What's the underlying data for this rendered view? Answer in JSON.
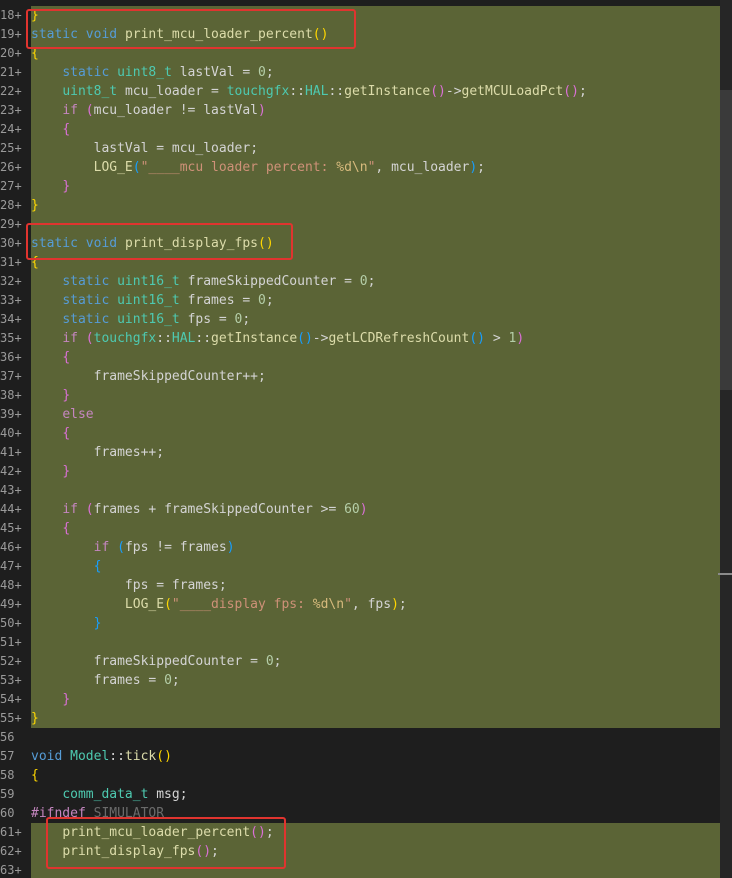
{
  "editor": {
    "lines": [
      {
        "n": "18",
        "m": "+",
        "hl": true,
        "segs": [
          [
            "pun",
            "}"
          ]
        ]
      },
      {
        "n": "19",
        "m": "+",
        "hl": true,
        "segs": [
          [
            "kw",
            "static"
          ],
          [
            "op",
            " "
          ],
          [
            "kw",
            "void"
          ],
          [
            "op",
            " "
          ],
          [
            "fn",
            "print_mcu_loader_percent"
          ],
          [
            "pun",
            "()"
          ]
        ]
      },
      {
        "n": "20",
        "m": "+",
        "hl": true,
        "segs": [
          [
            "pun",
            "{"
          ]
        ]
      },
      {
        "n": "21",
        "m": "+",
        "hl": true,
        "segs": [
          [
            "op",
            "    "
          ],
          [
            "kw",
            "static"
          ],
          [
            "op",
            " "
          ],
          [
            "ty",
            "uint8_t"
          ],
          [
            "op",
            " "
          ],
          [
            "id",
            "lastVal"
          ],
          [
            "op",
            " = "
          ],
          [
            "num",
            "0"
          ],
          [
            "op",
            ";"
          ]
        ]
      },
      {
        "n": "22",
        "m": "+",
        "hl": true,
        "segs": [
          [
            "op",
            "    "
          ],
          [
            "ty",
            "uint8_t"
          ],
          [
            "op",
            " "
          ],
          [
            "id",
            "mcu_loader"
          ],
          [
            "op",
            " = "
          ],
          [
            "ns",
            "touchgfx"
          ],
          [
            "op",
            "::"
          ],
          [
            "ns",
            "HAL"
          ],
          [
            "op",
            "::"
          ],
          [
            "fn",
            "getInstance"
          ],
          [
            "pr2",
            "()"
          ],
          [
            "op",
            "->"
          ],
          [
            "fn",
            "getMCULoadPct"
          ],
          [
            "pr2",
            "()"
          ],
          [
            "op",
            ";"
          ]
        ]
      },
      {
        "n": "23",
        "m": "+",
        "hl": true,
        "segs": [
          [
            "op",
            "    "
          ],
          [
            "mac",
            "if"
          ],
          [
            "op",
            " "
          ],
          [
            "pr2",
            "("
          ],
          [
            "id",
            "mcu_loader"
          ],
          [
            "op",
            " != "
          ],
          [
            "id",
            "lastVal"
          ],
          [
            "pr2",
            ")"
          ]
        ]
      },
      {
        "n": "24",
        "m": "+",
        "hl": true,
        "segs": [
          [
            "op",
            "    "
          ],
          [
            "pr2",
            "{"
          ]
        ]
      },
      {
        "n": "25",
        "m": "+",
        "hl": true,
        "segs": [
          [
            "op",
            "        "
          ],
          [
            "id",
            "lastVal"
          ],
          [
            "op",
            " = "
          ],
          [
            "id",
            "mcu_loader"
          ],
          [
            "op",
            ";"
          ]
        ]
      },
      {
        "n": "26",
        "m": "+",
        "hl": true,
        "segs": [
          [
            "op",
            "        "
          ],
          [
            "fn",
            "LOG_E"
          ],
          [
            "pr3",
            "("
          ],
          [
            "str",
            "\"____mcu loader percent: "
          ],
          [
            "esc",
            "%d\\n"
          ],
          [
            "str",
            "\""
          ],
          [
            "op",
            ", "
          ],
          [
            "id",
            "mcu_loader"
          ],
          [
            "pr3",
            ")"
          ],
          [
            "op",
            ";"
          ]
        ]
      },
      {
        "n": "27",
        "m": "+",
        "hl": true,
        "segs": [
          [
            "op",
            "    "
          ],
          [
            "pr2",
            "}"
          ]
        ]
      },
      {
        "n": "28",
        "m": "+",
        "hl": true,
        "segs": [
          [
            "pun",
            "}"
          ]
        ]
      },
      {
        "n": "29",
        "m": "+",
        "hl": true,
        "segs": []
      },
      {
        "n": "30",
        "m": "+",
        "hl": true,
        "segs": [
          [
            "kw",
            "static"
          ],
          [
            "op",
            " "
          ],
          [
            "kw",
            "void"
          ],
          [
            "op",
            " "
          ],
          [
            "fn",
            "print_display_fps"
          ],
          [
            "pun",
            "()"
          ]
        ]
      },
      {
        "n": "31",
        "m": "+",
        "hl": true,
        "segs": [
          [
            "pun",
            "{"
          ]
        ]
      },
      {
        "n": "32",
        "m": "+",
        "hl": true,
        "segs": [
          [
            "op",
            "    "
          ],
          [
            "kw",
            "static"
          ],
          [
            "op",
            " "
          ],
          [
            "ty",
            "uint16_t"
          ],
          [
            "op",
            " "
          ],
          [
            "id",
            "frameSkippedCounter"
          ],
          [
            "op",
            " = "
          ],
          [
            "num",
            "0"
          ],
          [
            "op",
            ";"
          ]
        ]
      },
      {
        "n": "33",
        "m": "+",
        "hl": true,
        "segs": [
          [
            "op",
            "    "
          ],
          [
            "kw",
            "static"
          ],
          [
            "op",
            " "
          ],
          [
            "ty",
            "uint16_t"
          ],
          [
            "op",
            " "
          ],
          [
            "id",
            "frames"
          ],
          [
            "op",
            " = "
          ],
          [
            "num",
            "0"
          ],
          [
            "op",
            ";"
          ]
        ]
      },
      {
        "n": "34",
        "m": "+",
        "hl": true,
        "segs": [
          [
            "op",
            "    "
          ],
          [
            "kw",
            "static"
          ],
          [
            "op",
            " "
          ],
          [
            "ty",
            "uint16_t"
          ],
          [
            "op",
            " "
          ],
          [
            "id",
            "fps"
          ],
          [
            "op",
            " = "
          ],
          [
            "num",
            "0"
          ],
          [
            "op",
            ";"
          ]
        ]
      },
      {
        "n": "35",
        "m": "+",
        "hl": true,
        "segs": [
          [
            "op",
            "    "
          ],
          [
            "mac",
            "if"
          ],
          [
            "op",
            " "
          ],
          [
            "pr2",
            "("
          ],
          [
            "ns",
            "touchgfx"
          ],
          [
            "op",
            "::"
          ],
          [
            "ns",
            "HAL"
          ],
          [
            "op",
            "::"
          ],
          [
            "fn",
            "getInstance"
          ],
          [
            "pr3",
            "()"
          ],
          [
            "op",
            "->"
          ],
          [
            "fn",
            "getLCDRefreshCount"
          ],
          [
            "pr3",
            "()"
          ],
          [
            "op",
            " > "
          ],
          [
            "num",
            "1"
          ],
          [
            "pr2",
            ")"
          ]
        ]
      },
      {
        "n": "36",
        "m": "+",
        "hl": true,
        "segs": [
          [
            "op",
            "    "
          ],
          [
            "pr2",
            "{"
          ]
        ]
      },
      {
        "n": "37",
        "m": "+",
        "hl": true,
        "segs": [
          [
            "op",
            "        "
          ],
          [
            "id",
            "frameSkippedCounter"
          ],
          [
            "op",
            "++;"
          ]
        ]
      },
      {
        "n": "38",
        "m": "+",
        "hl": true,
        "segs": [
          [
            "op",
            "    "
          ],
          [
            "pr2",
            "}"
          ]
        ]
      },
      {
        "n": "39",
        "m": "+",
        "hl": true,
        "segs": [
          [
            "op",
            "    "
          ],
          [
            "mac",
            "else"
          ]
        ]
      },
      {
        "n": "40",
        "m": "+",
        "hl": true,
        "segs": [
          [
            "op",
            "    "
          ],
          [
            "pr2",
            "{"
          ]
        ]
      },
      {
        "n": "41",
        "m": "+",
        "hl": true,
        "segs": [
          [
            "op",
            "        "
          ],
          [
            "id",
            "frames"
          ],
          [
            "op",
            "++;"
          ]
        ]
      },
      {
        "n": "42",
        "m": "+",
        "hl": true,
        "segs": [
          [
            "op",
            "    "
          ],
          [
            "pr2",
            "}"
          ]
        ]
      },
      {
        "n": "43",
        "m": "+",
        "hl": true,
        "segs": []
      },
      {
        "n": "44",
        "m": "+",
        "hl": true,
        "segs": [
          [
            "op",
            "    "
          ],
          [
            "mac",
            "if"
          ],
          [
            "op",
            " "
          ],
          [
            "pr2",
            "("
          ],
          [
            "id",
            "frames"
          ],
          [
            "op",
            " + "
          ],
          [
            "id",
            "frameSkippedCounter"
          ],
          [
            "op",
            " >= "
          ],
          [
            "num",
            "60"
          ],
          [
            "pr2",
            ")"
          ]
        ]
      },
      {
        "n": "45",
        "m": "+",
        "hl": true,
        "segs": [
          [
            "op",
            "    "
          ],
          [
            "pr2",
            "{"
          ]
        ]
      },
      {
        "n": "46",
        "m": "+",
        "hl": true,
        "segs": [
          [
            "op",
            "        "
          ],
          [
            "mac",
            "if"
          ],
          [
            "op",
            " "
          ],
          [
            "pr3",
            "("
          ],
          [
            "id",
            "fps"
          ],
          [
            "op",
            " != "
          ],
          [
            "id",
            "frames"
          ],
          [
            "pr3",
            ")"
          ]
        ]
      },
      {
        "n": "47",
        "m": "+",
        "hl": true,
        "segs": [
          [
            "op",
            "        "
          ],
          [
            "pr3",
            "{"
          ]
        ]
      },
      {
        "n": "48",
        "m": "+",
        "hl": true,
        "segs": [
          [
            "op",
            "            "
          ],
          [
            "id",
            "fps"
          ],
          [
            "op",
            " = "
          ],
          [
            "id",
            "frames"
          ],
          [
            "op",
            ";"
          ]
        ]
      },
      {
        "n": "49",
        "m": "+",
        "hl": true,
        "segs": [
          [
            "op",
            "            "
          ],
          [
            "fn",
            "LOG_E"
          ],
          [
            "pun",
            "("
          ],
          [
            "str",
            "\"____display fps: "
          ],
          [
            "esc",
            "%d\\n"
          ],
          [
            "str",
            "\""
          ],
          [
            "op",
            ", "
          ],
          [
            "id",
            "fps"
          ],
          [
            "pun",
            ")"
          ],
          [
            "op",
            ";"
          ]
        ]
      },
      {
        "n": "50",
        "m": "+",
        "hl": true,
        "segs": [
          [
            "op",
            "        "
          ],
          [
            "pr3",
            "}"
          ]
        ]
      },
      {
        "n": "51",
        "m": "+",
        "hl": true,
        "segs": []
      },
      {
        "n": "52",
        "m": "+",
        "hl": true,
        "segs": [
          [
            "op",
            "        "
          ],
          [
            "id",
            "frameSkippedCounter"
          ],
          [
            "op",
            " = "
          ],
          [
            "num",
            "0"
          ],
          [
            "op",
            ";"
          ]
        ]
      },
      {
        "n": "53",
        "m": "+",
        "hl": true,
        "segs": [
          [
            "op",
            "        "
          ],
          [
            "id",
            "frames"
          ],
          [
            "op",
            " = "
          ],
          [
            "num",
            "0"
          ],
          [
            "op",
            ";"
          ]
        ]
      },
      {
        "n": "54",
        "m": "+",
        "hl": true,
        "segs": [
          [
            "op",
            "    "
          ],
          [
            "pr2",
            "}"
          ]
        ]
      },
      {
        "n": "55",
        "m": "+",
        "hl": true,
        "segs": [
          [
            "pun",
            "}"
          ]
        ]
      },
      {
        "n": "56",
        "m": "",
        "hl": false,
        "segs": []
      },
      {
        "n": "57",
        "m": "",
        "hl": false,
        "segs": [
          [
            "kw",
            "void"
          ],
          [
            "op",
            " "
          ],
          [
            "ns",
            "Model"
          ],
          [
            "op",
            "::"
          ],
          [
            "fn",
            "tick"
          ],
          [
            "pun",
            "()"
          ]
        ]
      },
      {
        "n": "58",
        "m": "",
        "hl": false,
        "segs": [
          [
            "pun",
            "{"
          ]
        ]
      },
      {
        "n": "59",
        "m": "",
        "hl": false,
        "segs": [
          [
            "op",
            "    "
          ],
          [
            "ty",
            "comm_data_t"
          ],
          [
            "op",
            " "
          ],
          [
            "id",
            "msg"
          ],
          [
            "op",
            ";"
          ]
        ]
      },
      {
        "n": "60",
        "m": "",
        "hl": false,
        "segs": [
          [
            "pp",
            "#ifndef"
          ],
          [
            "op",
            " "
          ],
          [
            "ppn",
            "SIMULATOR"
          ]
        ]
      },
      {
        "n": "61",
        "m": "+",
        "hl": true,
        "segs": [
          [
            "op",
            "    "
          ],
          [
            "fn",
            "print_mcu_loader_percent"
          ],
          [
            "pr2",
            "()"
          ],
          [
            "op",
            ";"
          ]
        ]
      },
      {
        "n": "62",
        "m": "+",
        "hl": true,
        "segs": [
          [
            "op",
            "    "
          ],
          [
            "fn",
            "print_display_fps"
          ],
          [
            "pr2",
            "()"
          ],
          [
            "op",
            ";"
          ]
        ]
      },
      {
        "n": "63",
        "m": "+",
        "hl": true,
        "segs": []
      }
    ]
  }
}
